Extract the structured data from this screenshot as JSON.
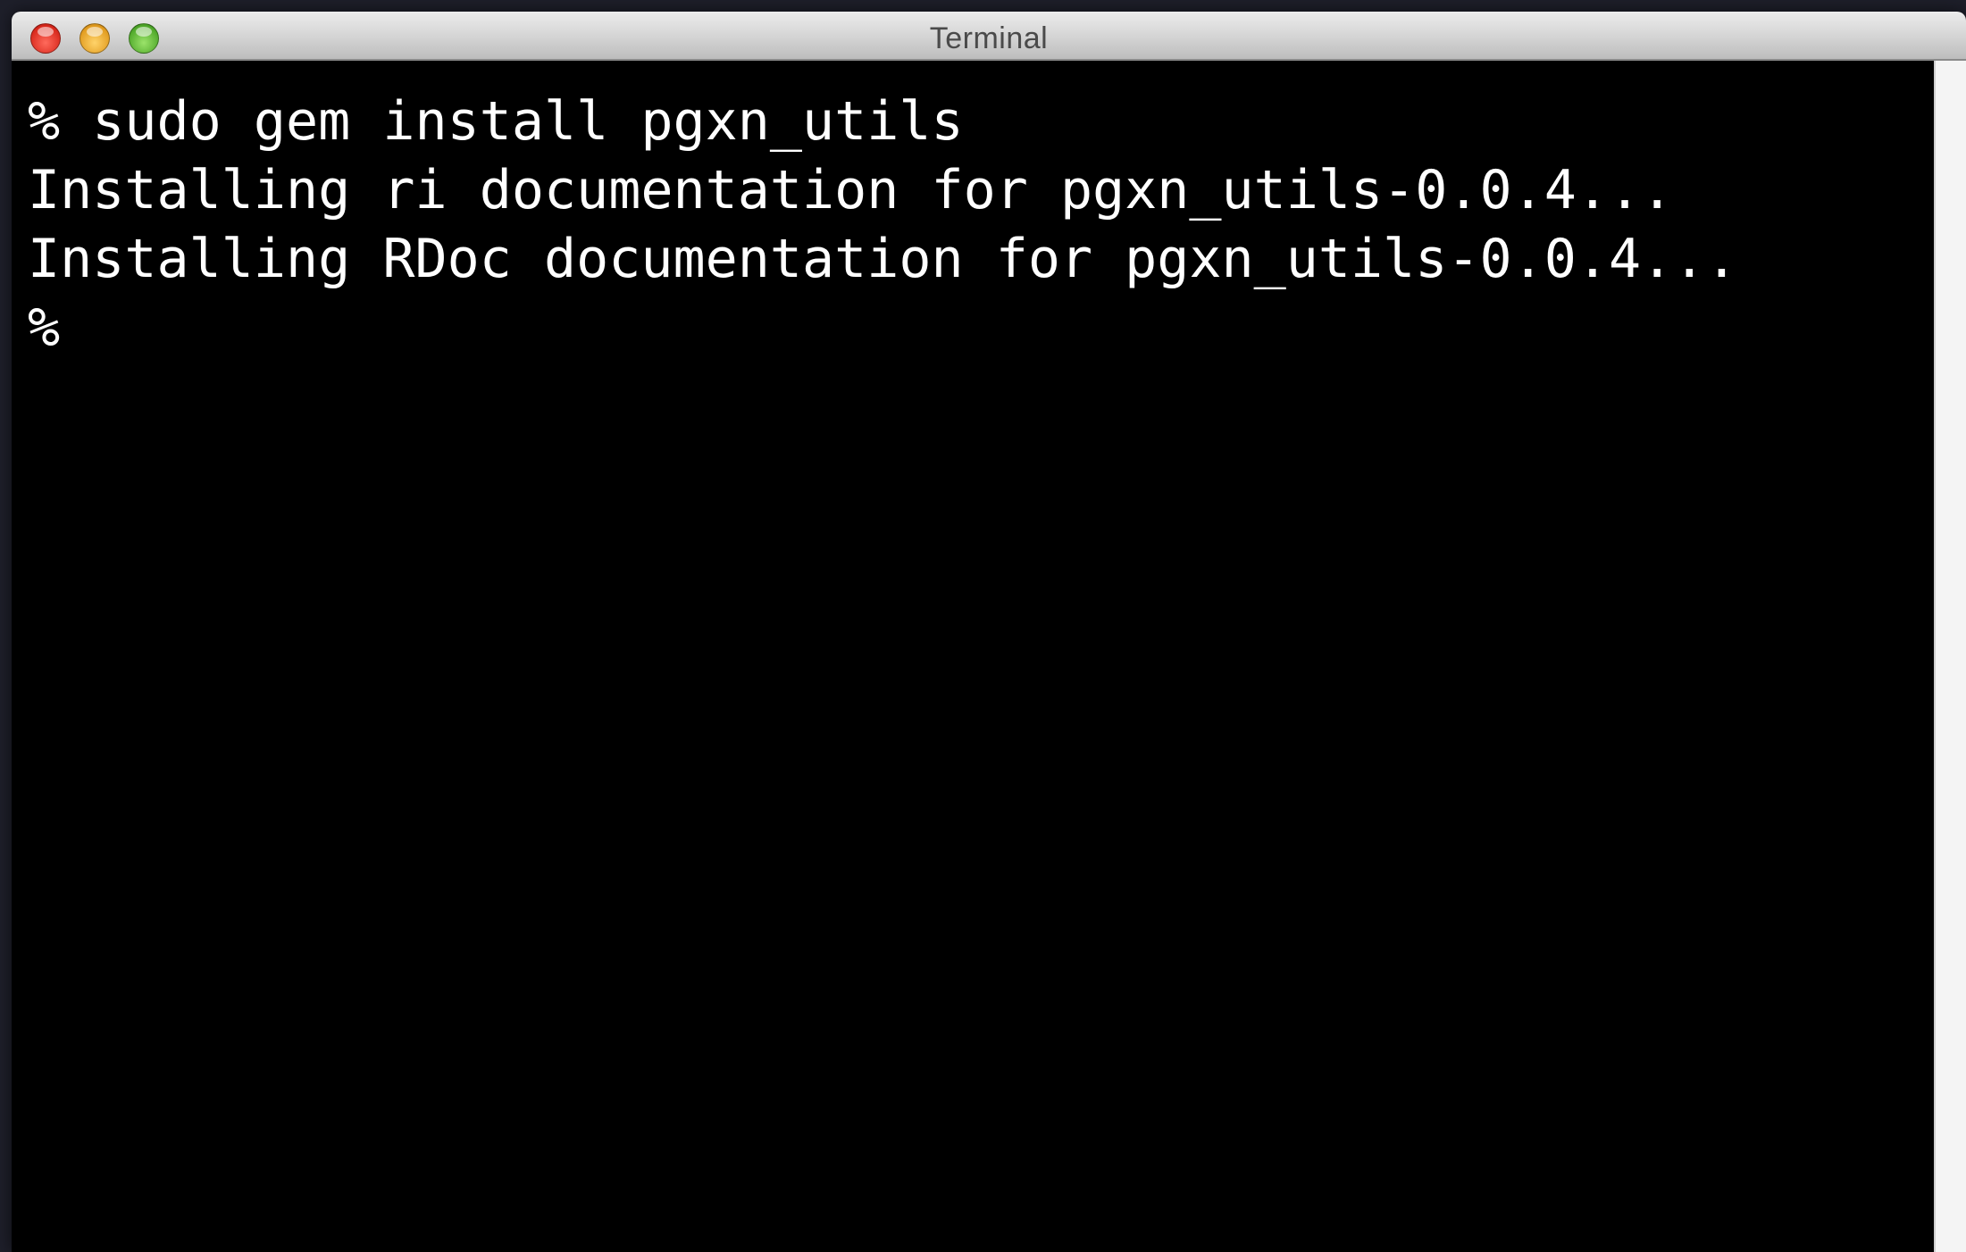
{
  "window": {
    "title": "Terminal"
  },
  "terminal": {
    "lines": [
      "% sudo gem install pgxn_utils",
      "Installing ri documentation for pgxn_utils-0.0.4...",
      "Installing RDoc documentation for pgxn_utils-0.0.4...",
      "%"
    ]
  },
  "colors": {
    "background": "#000000",
    "text": "#ffffff",
    "titlebar": "#d8d8d8"
  },
  "icons": {
    "close": "close-button-icon",
    "minimize": "minimize-button-icon",
    "zoom": "zoom-button-icon"
  }
}
